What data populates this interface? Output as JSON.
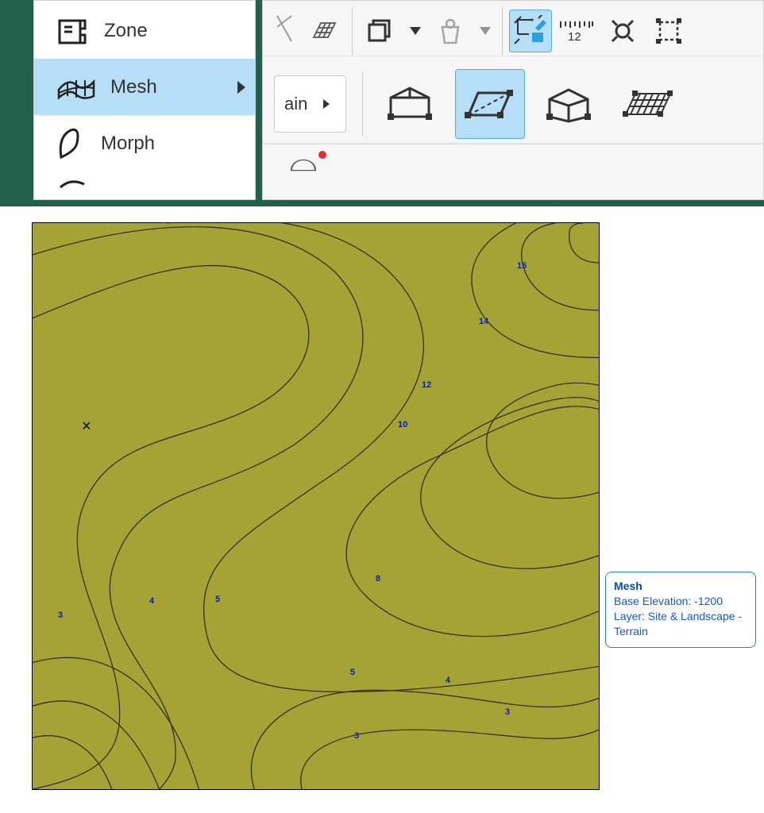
{
  "toolbox": {
    "zone": "Zone",
    "mesh": "Mesh",
    "morph": "Morph"
  },
  "terrain_chip": "ain",
  "ruler_text": "12",
  "tooltip": {
    "title": "Mesh",
    "line1": "Base Elevation: -1200",
    "line2": "Layer: Site & Landscape - Terrain"
  },
  "contour_labels": {
    "l15": "15",
    "l14": "14",
    "l12": "12",
    "l10": "10",
    "l8": "8",
    "l5": "5",
    "l4a": "4",
    "l4b": "4",
    "l3a": "3",
    "l3b": "3",
    "l3c": "3",
    "l5b": "5"
  },
  "marker": "×"
}
